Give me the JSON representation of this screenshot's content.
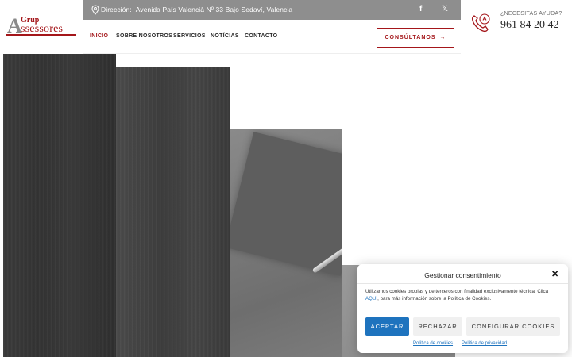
{
  "brand": {
    "logo_small": "Grup",
    "logo_letter": "A",
    "logo_word": "ssessores"
  },
  "topbar": {
    "address_label": "Dirección:",
    "address": "Avenida País Valencià Nº 33 Bajo Sedaví, Valencia",
    "icons": [
      "map-pin-icon",
      "facebook-icon",
      "x-icon"
    ],
    "facebook_glyph": "f",
    "x_glyph": "𝕏"
  },
  "nav": {
    "items": [
      {
        "label": "INICIO",
        "active": true
      },
      {
        "label": "SOBRE NOSOTROS",
        "active": false
      },
      {
        "label": "SERVICIOS",
        "active": false
      },
      {
        "label": "NOTÍCIAS",
        "active": false
      },
      {
        "label": "CONTACTO",
        "active": false
      }
    ],
    "cta_label": "CONSÚLTANOS",
    "cta_arrow": "→"
  },
  "help": {
    "question": "¿NECESITAS AYUDA?",
    "phone": "961 84 20 42"
  },
  "consent": {
    "title": "Gestionar consentimiento",
    "close_glyph": "✕",
    "text_before": "Utilizamos cookies propias y de terceros con finalidad exclusivamente técnica. Clica ",
    "text_link": "AQUÍ",
    "text_after": ", para más información sobre la Política de Cookies.",
    "accept": "ACEPTAR",
    "reject": "RECHAZAR",
    "configure": "CONFIGURAR COOKIES",
    "cookie_policy": "Política de cookies",
    "privacy_policy": "Política de privacidad"
  },
  "colors": {
    "brand_red": "#a4161a",
    "topbar_gray": "#8e8e8e",
    "accept_blue": "#1e73be"
  }
}
